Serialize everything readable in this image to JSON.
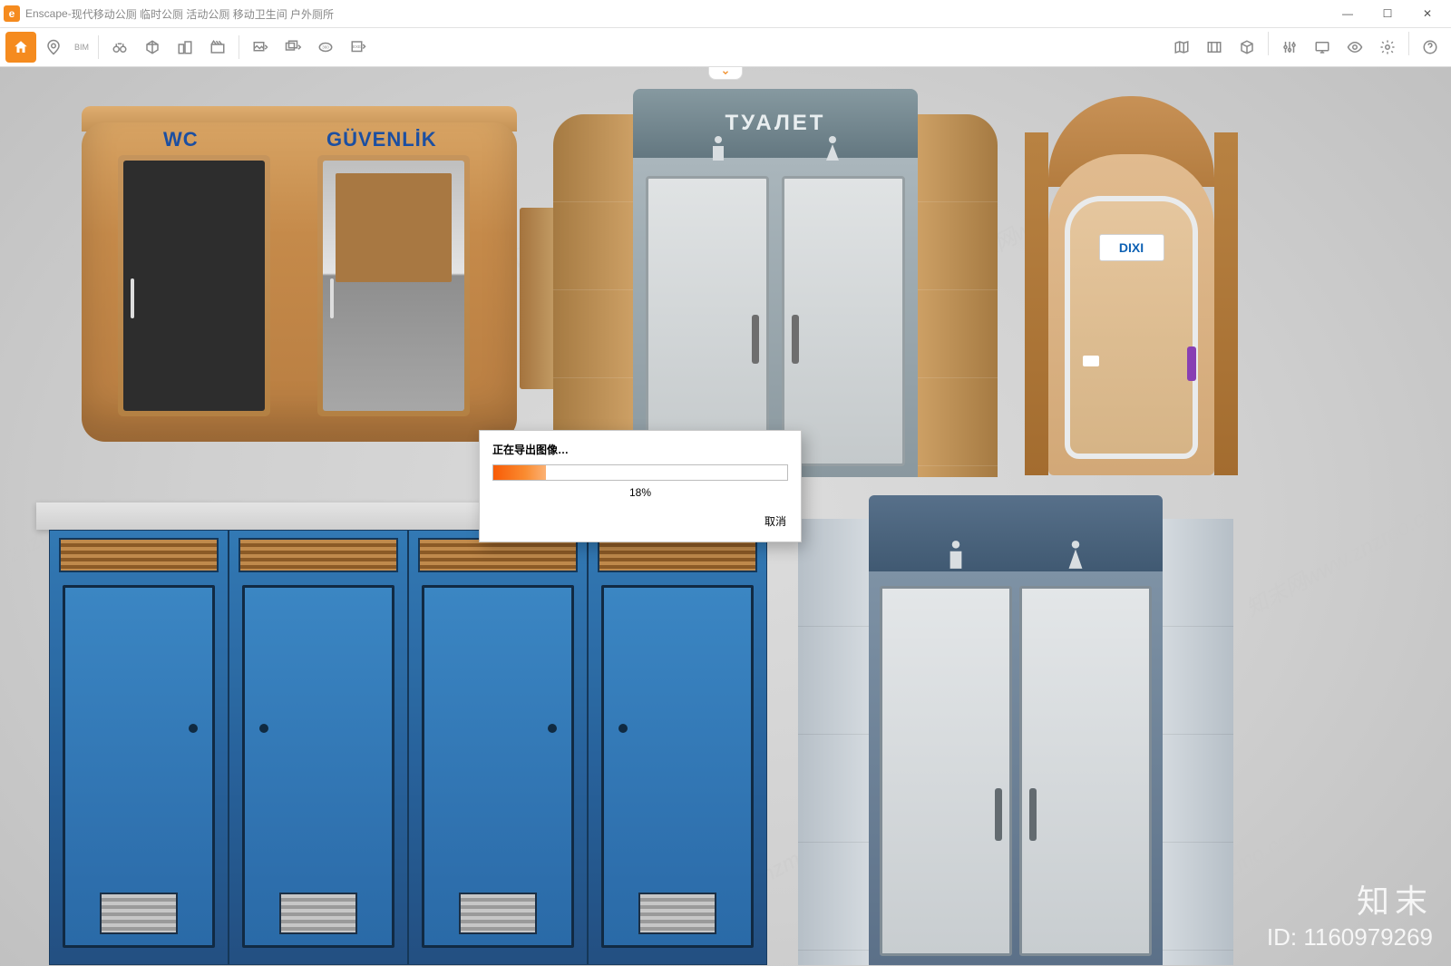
{
  "app": {
    "name": "Enscape",
    "title_sep": " - ",
    "doc_title": "现代移动公厕 临时公厕 活动公厕 移动卫生间 户外厕所"
  },
  "window_controls": {
    "min": "—",
    "max": "☐",
    "close": "✕"
  },
  "toolbar": {
    "bim_label": "BIM"
  },
  "dialog": {
    "title": "正在导出图像…",
    "percent_text": "18%",
    "percent_value": 18,
    "cancel": "取消"
  },
  "unit1": {
    "label_wc": "WC",
    "label_security": "GÜVENLİK"
  },
  "unit2": {
    "sign": "ТУАЛЕТ"
  },
  "unit3": {
    "brand": "DIXI"
  },
  "watermark": {
    "wm_text": "知末网www.znzmo.com",
    "brand": "知末",
    "id_label": "ID: 1160979269"
  }
}
